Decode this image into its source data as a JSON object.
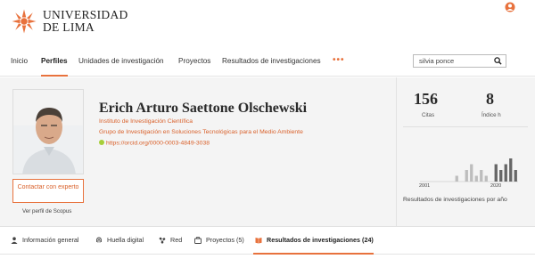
{
  "header": {
    "logo_line1": "UNIVERSIDAD",
    "logo_line2": "DE LIMA"
  },
  "nav": {
    "items": [
      "Inicio",
      "Perfiles",
      "Unidades de investigación",
      "Proyectos",
      "Resultados de investigaciones"
    ],
    "active": "Perfiles",
    "more_label": "•••"
  },
  "search": {
    "value": "silvia ponce"
  },
  "profile": {
    "name": "Erich Arturo Saettone Olschewski",
    "affiliations": [
      "Instituto de Investigación Científica",
      "Grupo de Investigación en Soluciones Tecnológicas para el Medio Ambiente"
    ],
    "orcid": "https://orcid.org/0000-0003-4849-3038",
    "contact_label": "Contactar con experto",
    "scopus_label": "Ver perfil de Scopus"
  },
  "metrics": {
    "citations": "156",
    "citations_label": "Citas",
    "h_index": "8",
    "h_index_label": "Índice h"
  },
  "chart_data": {
    "type": "bar",
    "x_start_label": "2001",
    "x_end_label": "2020",
    "caption": "Resultados de investigaciones por año",
    "values": [
      0,
      0,
      0,
      0,
      0,
      0,
      0,
      1,
      0,
      2,
      3,
      1,
      2,
      1,
      0,
      3,
      2,
      3,
      4,
      2
    ],
    "highlight_from_index": 14
  },
  "tabs": [
    {
      "label": "Información general",
      "icon": "person-icon"
    },
    {
      "label": "Huella digital",
      "icon": "fingerprint-icon"
    },
    {
      "label": "Red",
      "icon": "network-icon"
    },
    {
      "label": "Proyectos (5)",
      "icon": "projects-icon"
    },
    {
      "label": "Resultados de investigaciones (24)",
      "icon": "book-icon"
    }
  ],
  "colors": {
    "accent": "#e8723d",
    "orcid": "#a6ce39"
  }
}
